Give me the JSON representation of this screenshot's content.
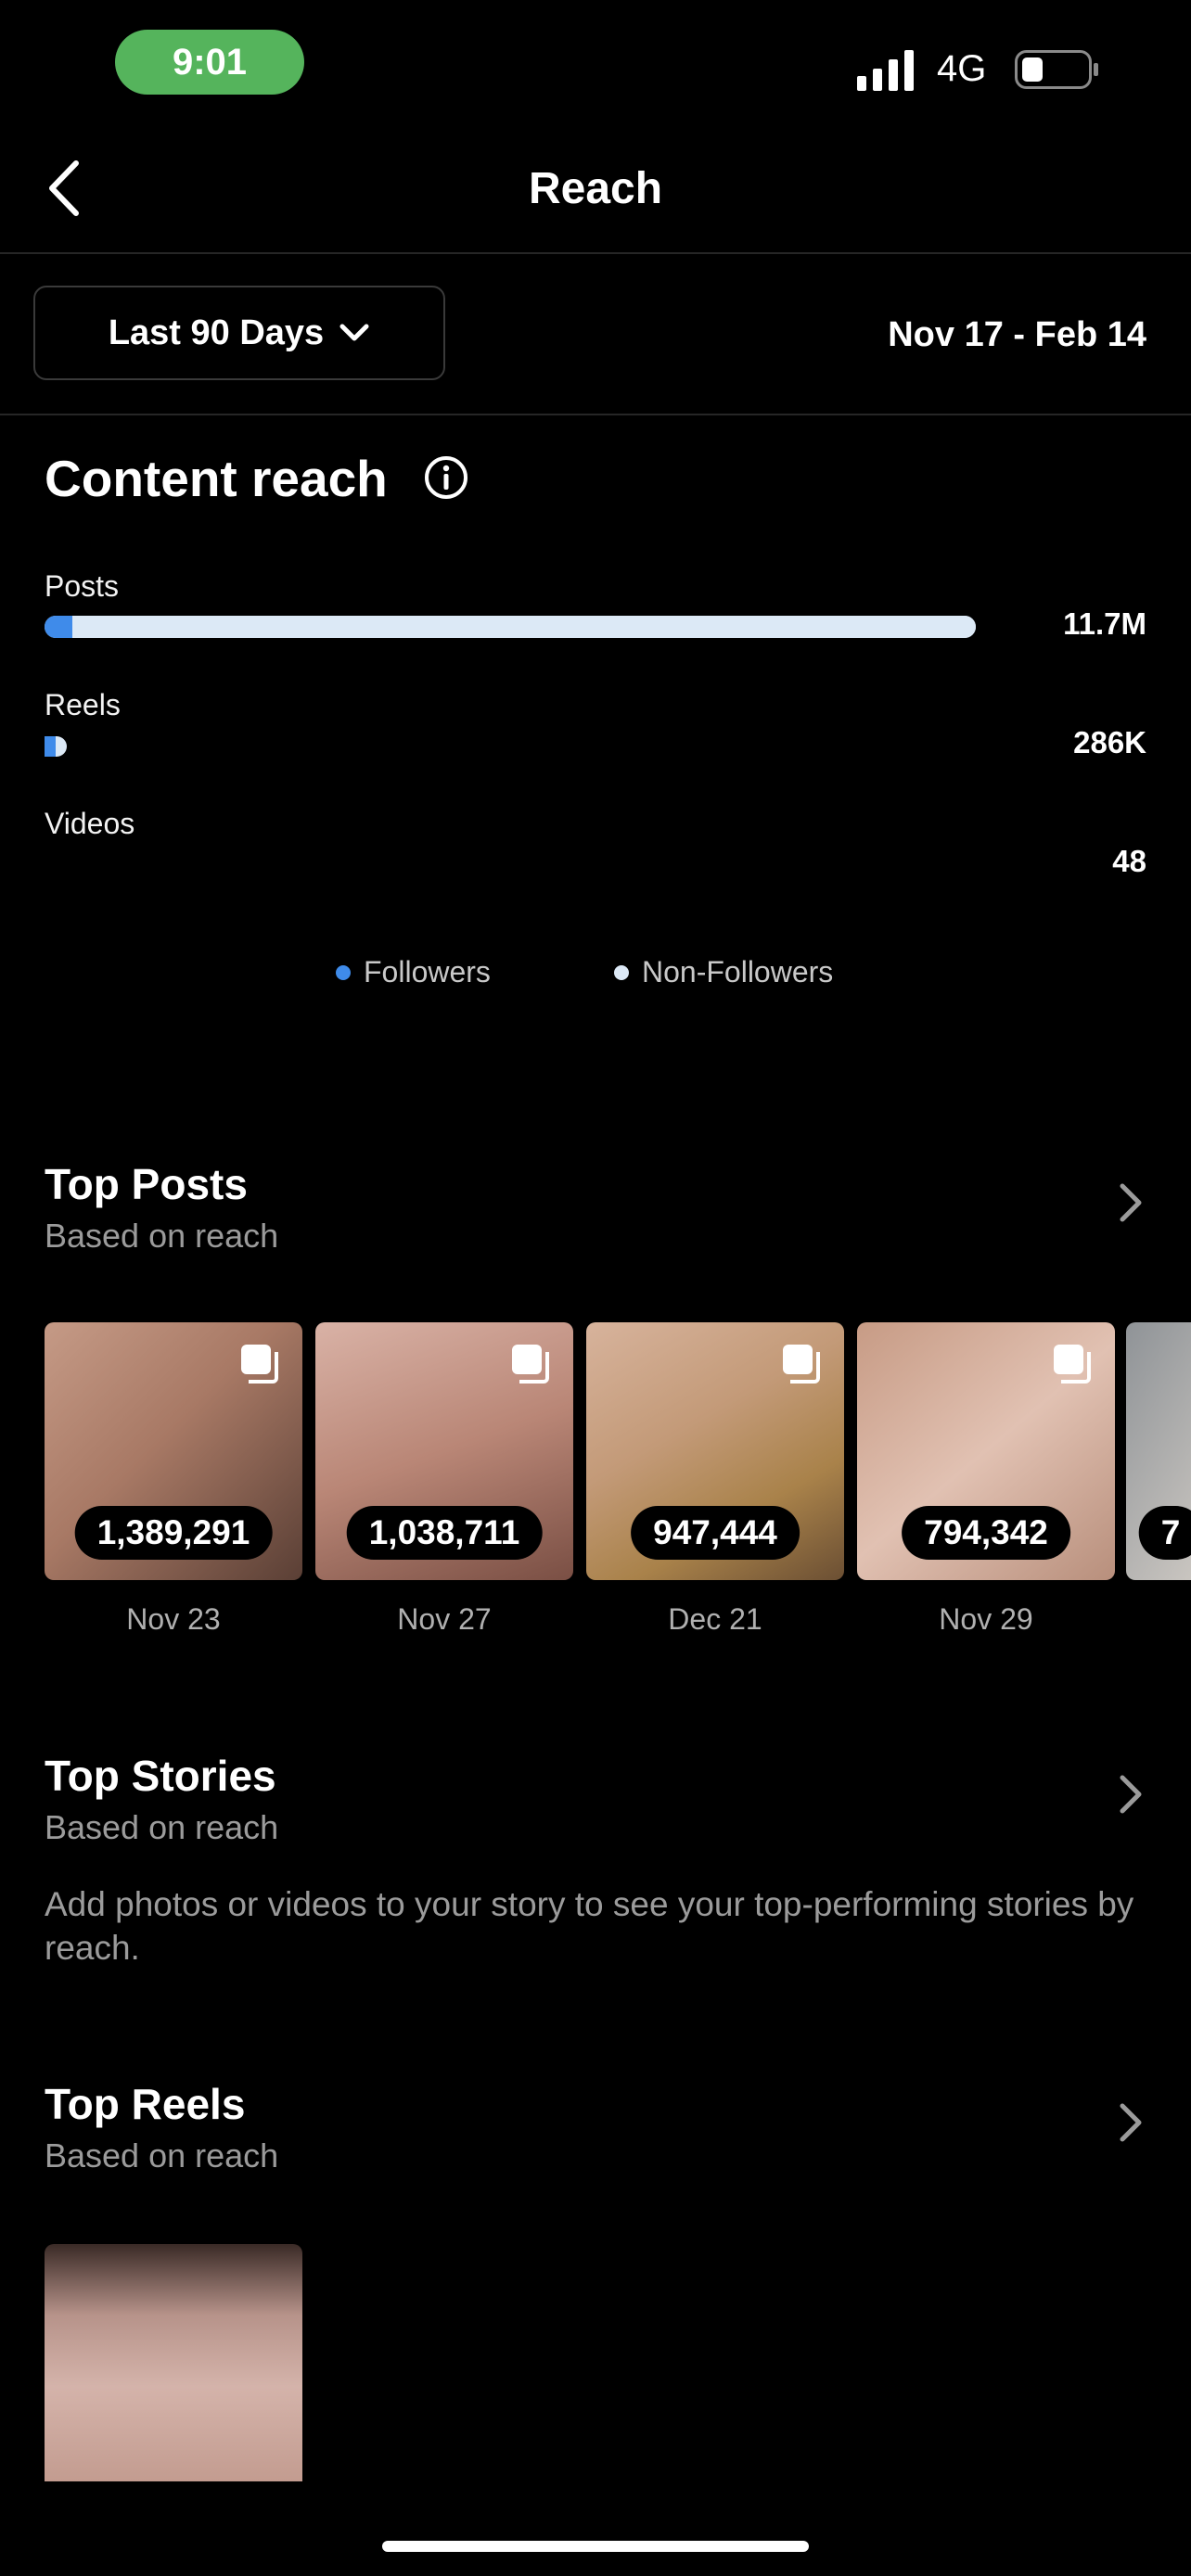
{
  "status_bar": {
    "time": "9:01",
    "network": "4G"
  },
  "nav": {
    "title": "Reach"
  },
  "filter": {
    "range_label": "Last 90 Days",
    "date_range": "Nov 17 - Feb 14"
  },
  "content_reach": {
    "title": "Content reach",
    "rows": [
      {
        "label": "Posts",
        "value": "11.7M",
        "followers_fraction": 0.03
      },
      {
        "label": "Reels",
        "value": "286K",
        "followers_fraction": 0.5
      },
      {
        "label": "Videos",
        "value": "48"
      }
    ],
    "legend": [
      {
        "label": "Followers",
        "color": "#3f8bea"
      },
      {
        "label": "Non-Followers",
        "color": "#dce9f6"
      }
    ]
  },
  "top_posts": {
    "title": "Top Posts",
    "subtitle": "Based on reach",
    "items": [
      {
        "reach": "1,389,291",
        "date": "Nov 23"
      },
      {
        "reach": "1,038,711",
        "date": "Nov 27"
      },
      {
        "reach": "947,444",
        "date": "Dec 21"
      },
      {
        "reach": "794,342",
        "date": "Nov 29"
      },
      {
        "reach": "7"
      }
    ]
  },
  "top_stories": {
    "title": "Top Stories",
    "subtitle": "Based on reach",
    "empty_message": "Add photos or videos to your story to see your top-performing stories by reach."
  },
  "top_reels": {
    "title": "Top Reels",
    "subtitle": "Based on reach"
  },
  "colors": {
    "accent_blue": "#3f8bea",
    "time_pill": "#55b45c"
  }
}
